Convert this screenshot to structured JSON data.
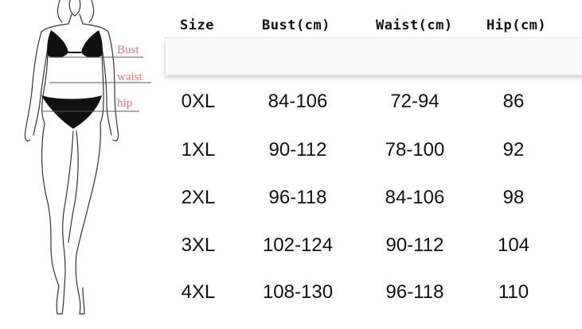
{
  "labels": {
    "bust": "Bust",
    "waist": "waist",
    "hip": "hip"
  },
  "table": {
    "headers": [
      "Size",
      "Bust(cm)",
      "Waist(cm)",
      "Hip(cm)"
    ],
    "rows": [
      [
        "0XL",
        "84-106",
        "72-94",
        "86"
      ],
      [
        "1XL",
        "90-112",
        "78-100",
        "92"
      ],
      [
        "2XL",
        "96-118",
        "84-106",
        "98"
      ],
      [
        "3XL",
        "102-124",
        "90-112",
        "104"
      ],
      [
        "4XL",
        "108-130",
        "96-118",
        "110"
      ]
    ]
  },
  "colors": {
    "label": "#e07a75",
    "text": "#111111",
    "header_bar": "#fafafa"
  }
}
